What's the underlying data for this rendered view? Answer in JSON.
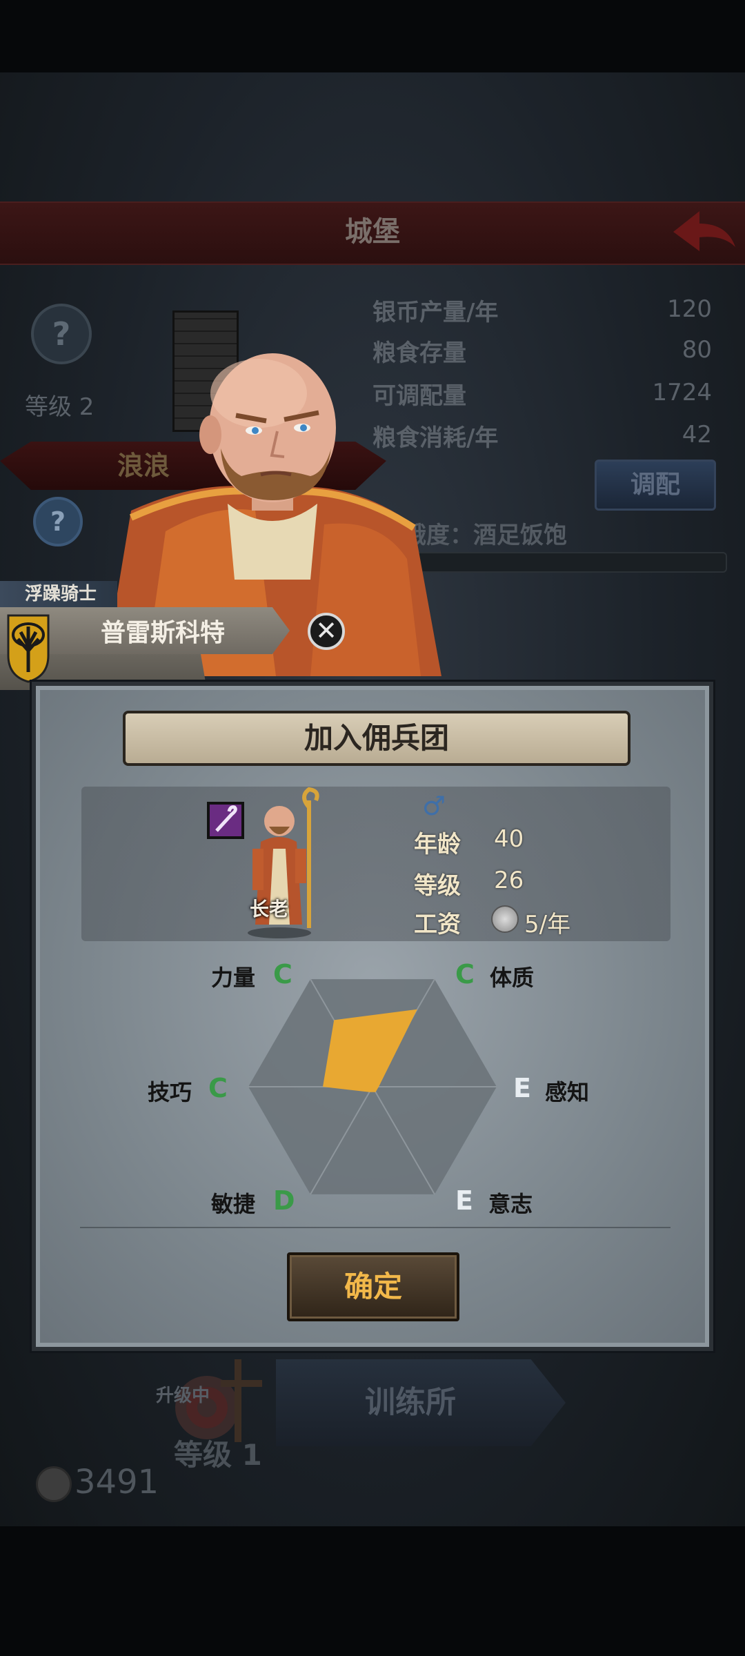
{
  "background": {
    "title": "城堡",
    "level_label": "等级 2",
    "stats": [
      {
        "label": "银币产量/年",
        "value": "120"
      },
      {
        "label": "粮食存量",
        "value": "80"
      },
      {
        "label": "可调配量",
        "value": "1724"
      },
      {
        "label": "粮食消耗/年",
        "value": "42"
      }
    ],
    "scroll_text": "浪浪",
    "adjust_button": "调配",
    "hunger_text": "饥饿度：酒足饭饱",
    "upgrading_text": "升级中",
    "training_building": "训练所",
    "training_level": "等级 1",
    "coins": "3491"
  },
  "character": {
    "mood": "浮躁骑士",
    "name": "普雷斯科特"
  },
  "dialog": {
    "title": "加入佣兵团",
    "unit_class": "长老",
    "gender_symbol": "♂",
    "age_label": "年龄",
    "age_value": "40",
    "level_label": "等级",
    "level_value": "26",
    "wage_label": "工资",
    "wage_value": "5/年",
    "attributes": [
      {
        "name": "力量",
        "grade": "C"
      },
      {
        "name": "体质",
        "grade": "C"
      },
      {
        "name": "感知",
        "grade": "E"
      },
      {
        "name": "意志",
        "grade": "E"
      },
      {
        "name": "敏捷",
        "grade": "D"
      },
      {
        "name": "技巧",
        "grade": "C"
      }
    ],
    "radar_levels": [
      0.62,
      0.72,
      0.05,
      0.05,
      0.05,
      0.4
    ],
    "radar_fill_color": "#e8a832",
    "confirm_button": "确定"
  }
}
